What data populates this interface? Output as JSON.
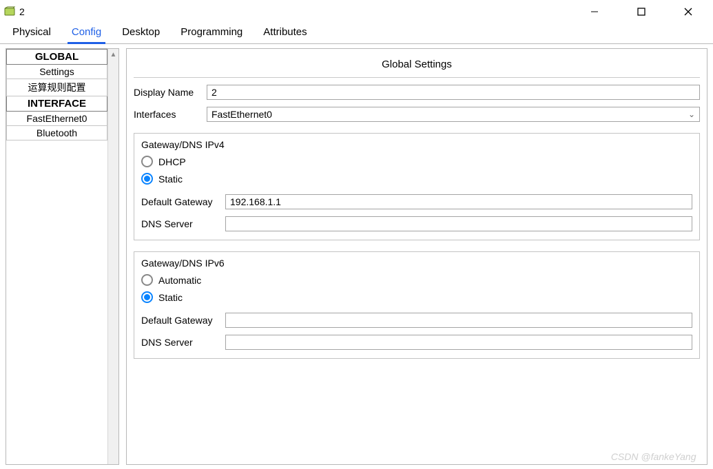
{
  "window": {
    "title": "2"
  },
  "tabs": {
    "physical": "Physical",
    "config": "Config",
    "desktop": "Desktop",
    "programming": "Programming",
    "attributes": "Attributes",
    "active": "config"
  },
  "sidebar": {
    "global_header": "GLOBAL",
    "global_items": [
      "Settings",
      "运算规则配置"
    ],
    "interface_header": "INTERFACE",
    "interface_items": [
      "FastEthernet0",
      "Bluetooth"
    ]
  },
  "main": {
    "title": "Global Settings",
    "display_name_label": "Display Name",
    "display_name_value": "2",
    "interfaces_label": "Interfaces",
    "interfaces_value": "FastEthernet0",
    "ipv4": {
      "title": "Gateway/DNS IPv4",
      "dhcp_label": "DHCP",
      "static_label": "Static",
      "selected": "static",
      "gateway_label": "Default Gateway",
      "gateway_value": "192.168.1.1",
      "dns_label": "DNS Server",
      "dns_value": ""
    },
    "ipv6": {
      "title": "Gateway/DNS IPv6",
      "auto_label": "Automatic",
      "static_label": "Static",
      "selected": "static",
      "gateway_label": "Default Gateway",
      "gateway_value": "",
      "dns_label": "DNS Server",
      "dns_value": ""
    }
  },
  "watermark": "CSDN @fankeYang\u0000"
}
